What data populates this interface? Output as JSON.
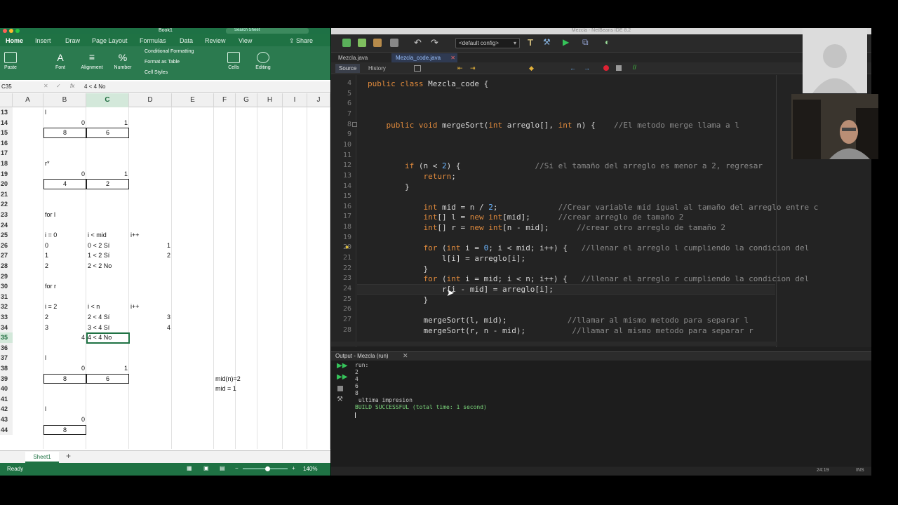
{
  "excel": {
    "app_menu_title": "Book1",
    "search_placeholder": "Search Sheet",
    "tabs": [
      "Home",
      "Insert",
      "Draw",
      "Page Layout",
      "Formulas",
      "Data",
      "Review",
      "View"
    ],
    "share_label": "Share",
    "ribbon": {
      "paste": "Paste",
      "font": "Font",
      "alignment": "Alignment",
      "number": "Number",
      "conditional_formatting": "Conditional Formatting",
      "format_as_table": "Format as Table",
      "cell_styles": "Cell Styles",
      "cells": "Cells",
      "editing": "Editing"
    },
    "name_box": "C35",
    "formula": "4 < 4 No",
    "columns": [
      "A",
      "B",
      "C",
      "D",
      "E",
      "F",
      "G",
      "H",
      "I",
      "J"
    ],
    "rows": [
      {
        "n": "13",
        "cells": {
          "B": "l"
        }
      },
      {
        "n": "14",
        "cells": {
          "B": "0",
          "C": "1"
        }
      },
      {
        "n": "15",
        "cells": {
          "B": "8",
          "C": "6"
        }
      },
      {
        "n": "16",
        "cells": {}
      },
      {
        "n": "17",
        "cells": {}
      },
      {
        "n": "18",
        "cells": {
          "B": "r*"
        }
      },
      {
        "n": "19",
        "cells": {
          "B": "0",
          "C": "1"
        }
      },
      {
        "n": "20",
        "cells": {
          "B": "4",
          "C": "2"
        }
      },
      {
        "n": "21",
        "cells": {}
      },
      {
        "n": "22",
        "cells": {}
      },
      {
        "n": "23",
        "cells": {
          "B": "for l"
        }
      },
      {
        "n": "24",
        "cells": {}
      },
      {
        "n": "25",
        "cells": {
          "B": "i = 0",
          "C": "i < mid",
          "D": "i++"
        }
      },
      {
        "n": "26",
        "cells": {
          "B": "0",
          "C": "0 < 2 Sí",
          "D": "1"
        }
      },
      {
        "n": "27",
        "cells": {
          "B": "1",
          "C": "1 < 2 Sí",
          "D": "2"
        }
      },
      {
        "n": "28",
        "cells": {
          "B": "2",
          "C": "2 < 2 No"
        }
      },
      {
        "n": "29",
        "cells": {}
      },
      {
        "n": "30",
        "cells": {
          "B": "for r"
        }
      },
      {
        "n": "31",
        "cells": {}
      },
      {
        "n": "32",
        "cells": {
          "B": "i = 2",
          "C": "i < n",
          "D": "i++"
        }
      },
      {
        "n": "33",
        "cells": {
          "B": "2",
          "C": "2 < 4 Sí",
          "D": "3"
        }
      },
      {
        "n": "34",
        "cells": {
          "B": "3",
          "C": "3 < 4 Sí",
          "D": "4"
        }
      },
      {
        "n": "35",
        "cells": {
          "B": "4",
          "C": "4 < 4 No"
        }
      },
      {
        "n": "36",
        "cells": {}
      },
      {
        "n": "37",
        "cells": {
          "B": "l"
        }
      },
      {
        "n": "38",
        "cells": {
          "B": "0",
          "C": "1"
        }
      },
      {
        "n": "39",
        "cells": {
          "B": "8",
          "C": "6",
          "F": "mid(n)=2"
        }
      },
      {
        "n": "40",
        "cells": {
          "F": "mid = 1"
        }
      },
      {
        "n": "41",
        "cells": {}
      },
      {
        "n": "42",
        "cells": {
          "B": "l"
        }
      },
      {
        "n": "43",
        "cells": {
          "B": "0"
        }
      },
      {
        "n": "44",
        "cells": {
          "B": "8"
        }
      }
    ],
    "sheet_tab": "Sheet1",
    "status": "Ready",
    "zoom": "140%"
  },
  "netbeans": {
    "window_title": "Mezcla - NetBeans IDE 8.2",
    "config": "<default config>",
    "file_tabs": [
      "Mezcla.java",
      "Mezcla_code.java"
    ],
    "editor_tabs": [
      "Source",
      "History"
    ],
    "code": [
      {
        "ln": "4",
        "text": "public class Mezcla_code {"
      },
      {
        "ln": "5",
        "text": ""
      },
      {
        "ln": "6",
        "text": ""
      },
      {
        "ln": "7",
        "text": ""
      },
      {
        "ln": "8",
        "text": "    public void mergeSort(int arreglo[], int n) {    //El metodo merge llama a l"
      },
      {
        "ln": "9",
        "text": ""
      },
      {
        "ln": "10",
        "text": ""
      },
      {
        "ln": "11",
        "text": ""
      },
      {
        "ln": "12",
        "text": "        if (n < 2) {                //Si el tamaño del arreglo es menor a 2, regresar"
      },
      {
        "ln": "13",
        "text": "            return;"
      },
      {
        "ln": "14",
        "text": "        }"
      },
      {
        "ln": "15",
        "text": ""
      },
      {
        "ln": "16",
        "text": "            int mid = n / 2;             //Crear variable mid igual al tamaño del arreglo entre c"
      },
      {
        "ln": "17",
        "text": "            int[] l = new int[mid];      //crear arreglo de tamaño 2"
      },
      {
        "ln": "18",
        "text": "            int[] r = new int[n - mid];      //crear otro arreglo de tamaño 2"
      },
      {
        "ln": "19",
        "text": ""
      },
      {
        "ln": "20",
        "text": "            for (int i = 0; i < mid; i++) {   //llenar el arreglo l cumpliendo la condicion del"
      },
      {
        "ln": "21",
        "text": "                l[i] = arreglo[i];"
      },
      {
        "ln": "22",
        "text": "            }"
      },
      {
        "ln": "23",
        "text": "            for (int i = mid; i < n; i++) {   //llenar el arreglo r cumpliendo la condicion del"
      },
      {
        "ln": "24",
        "text": "                r[i - mid] = arreglo[i];"
      },
      {
        "ln": "25",
        "text": "            }"
      },
      {
        "ln": "26",
        "text": ""
      },
      {
        "ln": "27",
        "text": "            mergeSort(l, mid);             //llamar al mismo metodo para separar l"
      },
      {
        "ln": "28",
        "text": "            mergeSort(r, n - mid);          //llamar al mismo metodo para separar r"
      }
    ],
    "output_title": "Output - Mezcla (run)",
    "output": [
      "run:",
      "2",
      "4",
      "6",
      "8",
      " ultima impresion",
      "BUILD SUCCESSFUL (total time: 1 second)"
    ],
    "cursor_pos": "24:19",
    "insert_mode": "INS"
  },
  "colors": {
    "excel_green": "#1f7244",
    "netbeans_bg": "#232323",
    "keyword": "#e08a3c",
    "comment": "#8a8a8a"
  }
}
